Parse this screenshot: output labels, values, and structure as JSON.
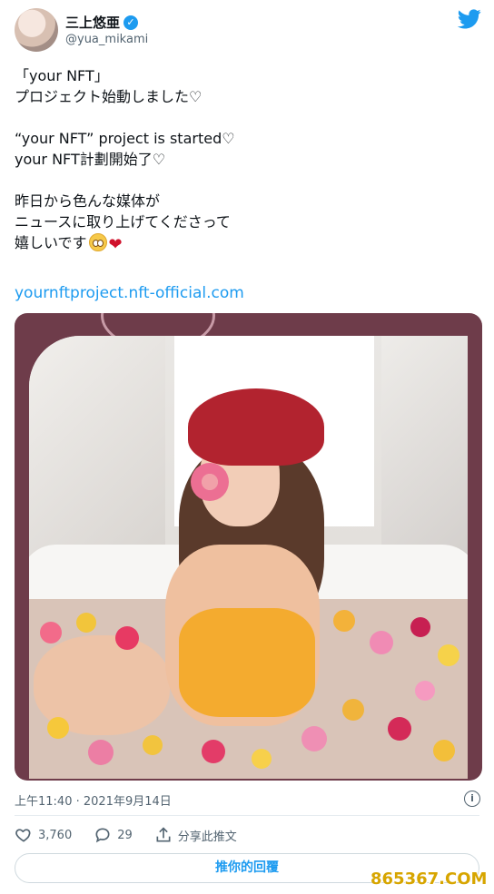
{
  "author": {
    "display_name": "三上悠亜",
    "handle": "@yua_mikami",
    "verified_mark": "✓"
  },
  "tweet": {
    "lines": [
      "「your NFT」",
      "プロジェクト始動しました♡",
      "",
      "“your NFT” project is started♡",
      "your NFT計劃開始了♡",
      "",
      "昨日から色んな媒体が",
      "ニュースに取り上げてくださって",
      "嬉しいです"
    ],
    "link": "yournftproject.nft-official.com",
    "emojis": [
      "smiling-face-icon",
      "heart-icon"
    ]
  },
  "meta": {
    "timestamp": "上午11:40 · 2021年9月14日",
    "info_symbol": "i"
  },
  "actions": {
    "likes": "3,760",
    "replies": "29",
    "share_label": "分享此推文"
  },
  "reply_button": "推你的回覆",
  "watermark": "865367.COM",
  "colors": {
    "accent": "#1d9bf0",
    "text": "#0f1419",
    "muted": "#536471",
    "media_bg": "#6e3c4a"
  }
}
